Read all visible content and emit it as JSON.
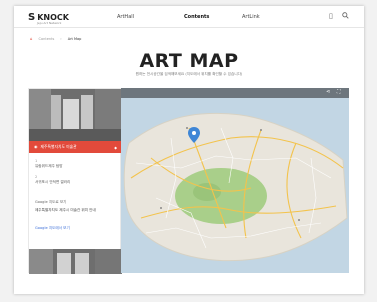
{
  "logo": {
    "mark": "S",
    "name": "KNOCK",
    "tagline": "Jeju Art Network"
  },
  "nav": {
    "items": [
      {
        "label": "ArtHall",
        "active": false
      },
      {
        "label": "Contents",
        "active": true
      },
      {
        "label": "ArtLink",
        "active": false
      }
    ],
    "icons": [
      "bookmark-icon",
      "search-icon"
    ]
  },
  "breadcrumb": {
    "home_icon": "home-icon",
    "level1": "Contents",
    "current": "Art Map"
  },
  "page": {
    "title": "ART MAP",
    "subtitle": "원하는 전시공간을 검색해보세요 (지도에서 위치를 확인할 수 있습니다)"
  },
  "sidebar": {
    "selected": "제주특별자치도 미술관",
    "entries": [
      {
        "num": "1",
        "text": "유람위드제주 탐방"
      },
      {
        "num": "2",
        "text": "서귀포시 안덕면 갤러리"
      }
    ],
    "google_title": "Google 지도로 보기",
    "google_text": "제주특별자치도 제주시 미술관 위치 안내",
    "google_link": "Google 지도에서 보기"
  },
  "map": {
    "toolbar_icons": [
      "share-icon",
      "fullscreen-icon"
    ]
  },
  "colors": {
    "accent": "#e24a3b",
    "map_water": "#c2d6e4",
    "map_land": "#e9e5dc",
    "map_green": "#a9cf8a",
    "link": "#3d6fd8"
  }
}
